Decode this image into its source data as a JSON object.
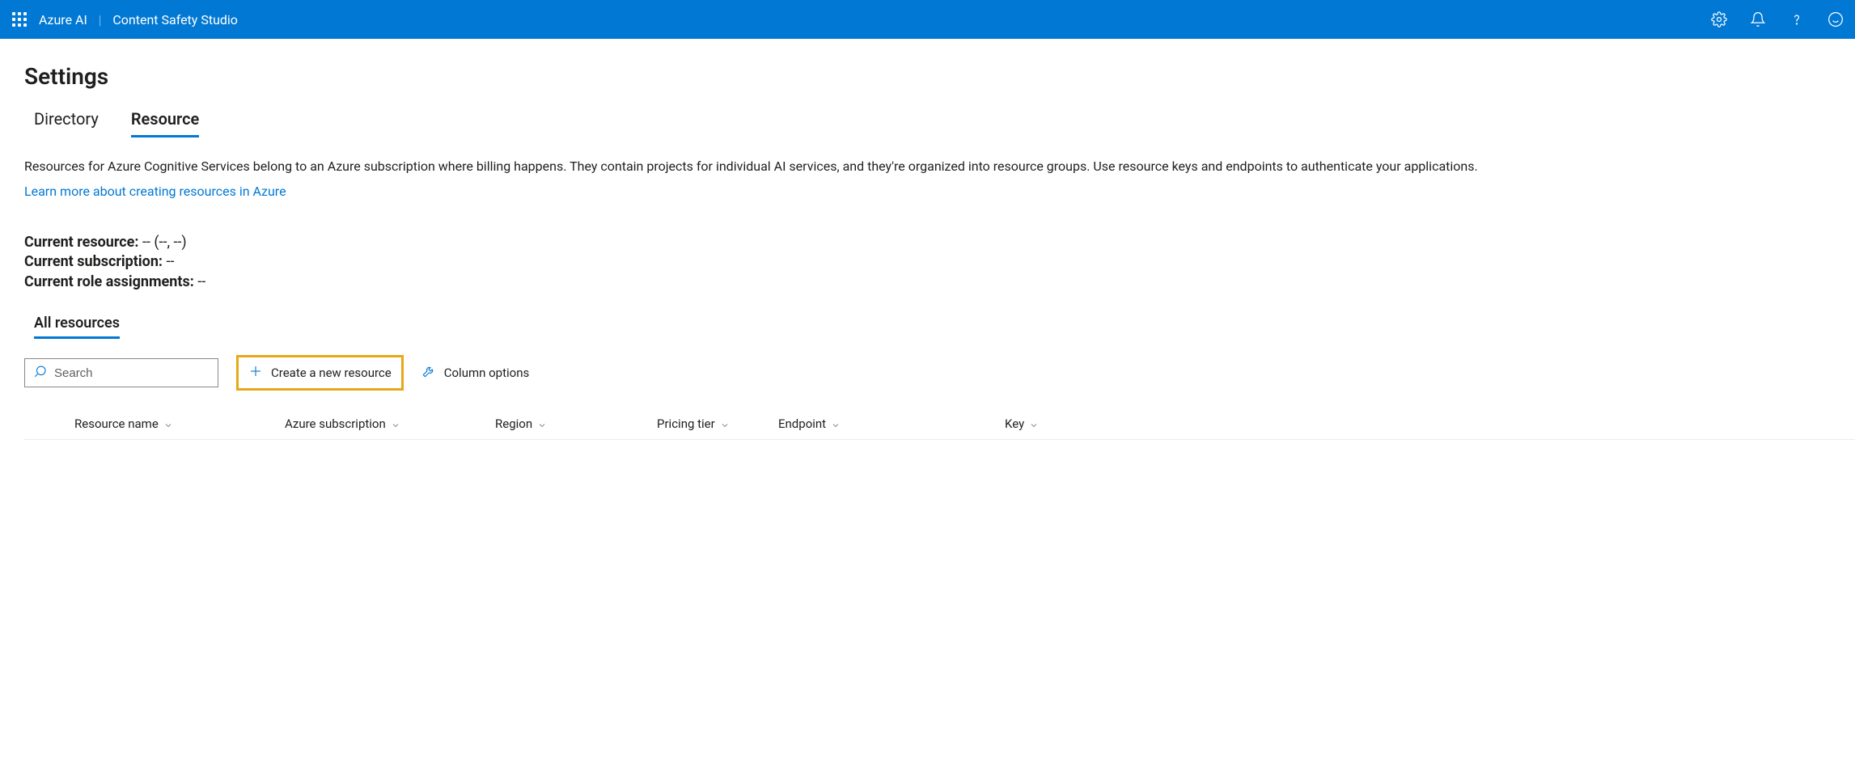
{
  "header": {
    "brand": "Azure AI",
    "subtitle": "Content Safety Studio"
  },
  "page": {
    "title": "Settings"
  },
  "tabs": [
    {
      "label": "Directory",
      "active": false
    },
    {
      "label": "Resource",
      "active": true
    }
  ],
  "description": "Resources for Azure Cognitive Services belong to an Azure subscription where billing happens. They contain projects for individual AI services, and they're organized into resource groups. Use resource keys and endpoints to authenticate your applications.",
  "learnMore": "Learn more about creating resources in Azure",
  "current": {
    "resourceLabel": "Current resource:",
    "resourceValue": "-- (--, --)",
    "subscriptionLabel": "Current subscription:",
    "subscriptionValue": "--",
    "roleLabel": "Current role assignments:",
    "roleValue": "--"
  },
  "allResources": {
    "tab": "All resources",
    "searchPlaceholder": "Search",
    "createLabel": "Create a new resource",
    "columnOptionsLabel": "Column options"
  },
  "columns": [
    "Resource name",
    "Azure subscription",
    "Region",
    "Pricing tier",
    "Endpoint",
    "Key"
  ]
}
